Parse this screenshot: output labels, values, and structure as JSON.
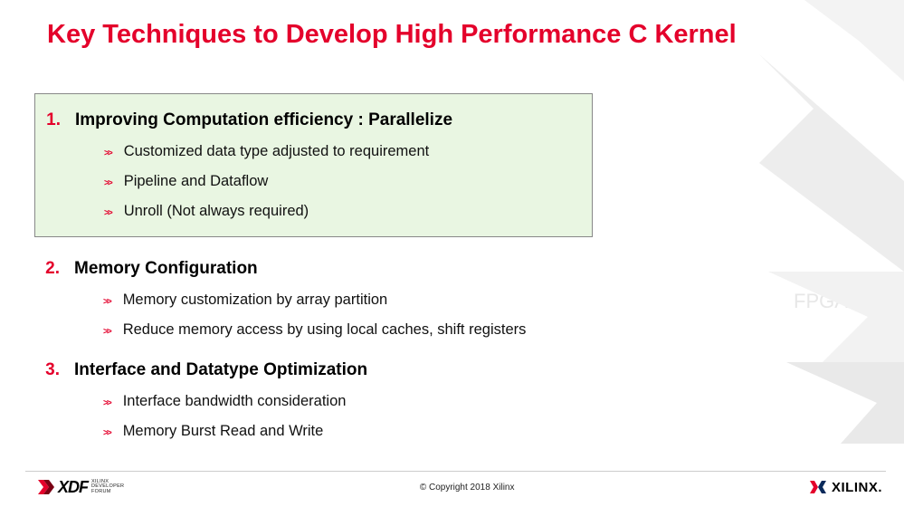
{
  "title": "Key Techniques to Develop High Performance C Kernel",
  "sections": [
    {
      "num": "1.",
      "heading": "Improving Computation efficiency : Parallelize",
      "highlight": true,
      "subs": [
        "Customized data type adjusted to requirement",
        "Pipeline and Dataflow",
        "Unroll (Not always required)"
      ]
    },
    {
      "num": "2.",
      "heading": "Memory Configuration",
      "highlight": false,
      "subs": [
        "Memory customization by array partition",
        "Reduce memory access by using local caches, shift registers"
      ]
    },
    {
      "num": "3.",
      "heading": "Interface and Datatype Optimization",
      "highlight": false,
      "subs": [
        "Interface bandwidth consideration",
        "Memory Burst Read and Write"
      ]
    }
  ],
  "footer": {
    "xdf_text": "XDF",
    "xdf_sub1": "XILINX",
    "xdf_sub2": "DEVELOPER",
    "xdf_sub3": "FORUM",
    "copyright": "© Copyright 2018 Xilinx",
    "xilinx": "XILINX"
  },
  "bg_watermark": "FPGA"
}
